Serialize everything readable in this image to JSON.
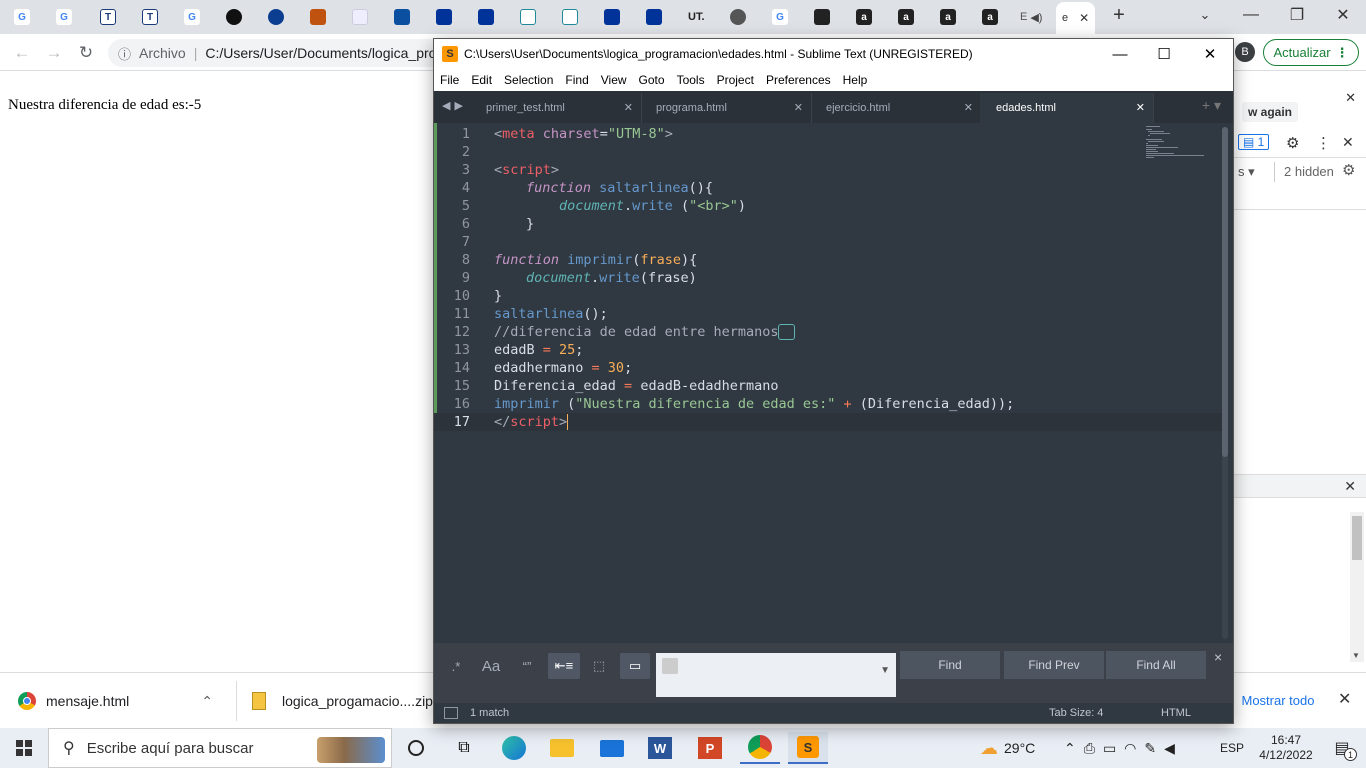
{
  "browser": {
    "tab_labels": [
      "G",
      "G",
      "T",
      "T",
      "G",
      "",
      "",
      "",
      "",
      "",
      "",
      "",
      "",
      "",
      "",
      "",
      "UT.",
      "",
      "G",
      "",
      "a",
      "a",
      "a",
      "a",
      "E",
      "e"
    ],
    "active_tab_label": "e",
    "active_tab_close": "✕",
    "new_tab": "+",
    "address_prefix": "Archivo",
    "address_url": "C:/Users/User/Documents/logica_pro",
    "profile_initial": "B",
    "update_label": "Actualizar"
  },
  "page": {
    "output_text": "Nuestra diferencia de edad es:-5"
  },
  "devtools": {
    "banner_text": "w again",
    "issues_count": "1",
    "hidden_label": "2 hidden",
    "filter_suffix": "s"
  },
  "sublime": {
    "title": "C:\\Users\\User\\Documents\\logica_programacion\\edades.html - Sublime Text (UNREGISTERED)",
    "menu": [
      "File",
      "Edit",
      "Selection",
      "Find",
      "View",
      "Goto",
      "Tools",
      "Project",
      "Preferences",
      "Help"
    ],
    "tabs": [
      {
        "label": "primer_test.html"
      },
      {
        "label": "programa.html"
      },
      {
        "label": "ejercicio.html"
      },
      {
        "label": "edades.html"
      }
    ],
    "line_numbers": [
      "1",
      "2",
      "3",
      "4",
      "5",
      "6",
      "7",
      "8",
      "9",
      "10",
      "11",
      "12",
      "13",
      "14",
      "15",
      "16",
      "17"
    ],
    "code": {
      "l1_tag_open": "<",
      "l1_tag": "meta",
      "l1_attr": " charset",
      "l1_eq": "=",
      "l1_val": "\"UTM-8\"",
      "l1_close": ">",
      "l3_open": "<",
      "l3_tag": "script",
      "l3_close": ">",
      "l4_kw": "function",
      "l4_fn": "saltarlinea",
      "l4_rest": "(){",
      "l5_obj": "document",
      "l5_dot": ".",
      "l5_method": "write",
      "l5_p1": " (",
      "l5_str": "\"<br>\"",
      "l5_p2": ")",
      "l6_text": "}",
      "l8_kw": "function",
      "l8_fn": "imprimir",
      "l8_p1": "(",
      "l8_param": "frase",
      "l8_p2": "){",
      "l9_obj": "document",
      "l9_dot": ".",
      "l9_method": "write",
      "l9_rest": "(frase)",
      "l10_text": "}",
      "l11_fn": "saltarlinea",
      "l11_rest": "();",
      "l12_comment": "//diferencia de edad entre hermanos",
      "l13_var": "edadB",
      "l13_op": " = ",
      "l13_num": "25",
      "l13_end": ";",
      "l14_var": "edadhermano",
      "l14_op": " = ",
      "l14_num": "30",
      "l14_end": ";",
      "l15_var": "Diferencia_edad",
      "l15_op": " = ",
      "l15_rest": "edadB-edadhermano",
      "l16_fn": "imprimir",
      "l16_p1": " (",
      "l16_str": "\"Nuestra diferencia de edad es:\"",
      "l16_op": " + ",
      "l16_rest": "(Diferencia_edad));",
      "l17_open": "</",
      "l17_tag": "script",
      "l17_close": ">"
    },
    "find": {
      "regex": ".*",
      "case": "Aa",
      "word": "“”",
      "find_btn": "Find",
      "find_prev_btn": "Find Prev",
      "find_all_btn": "Find All",
      "close": "×"
    },
    "status": {
      "matches": "1 match",
      "tab_size": "Tab Size: 4",
      "syntax": "HTML"
    }
  },
  "downloads": {
    "items": [
      {
        "name": "mensaje.html"
      },
      {
        "name": "logica_progamacio....zip"
      }
    ],
    "show_all": "Mostrar todo"
  },
  "taskbar": {
    "search_placeholder": "Escribe aquí para buscar",
    "weather": "29°C",
    "language": "ESP",
    "time": "16:47",
    "date": "4/12/2022",
    "notification_count": "1"
  }
}
